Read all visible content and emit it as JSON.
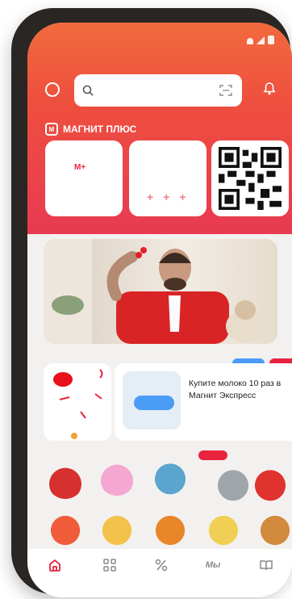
{
  "search": {
    "placeholder": ""
  },
  "brand": {
    "mark": "М",
    "name": "МАГНИТ ПЛЮС"
  },
  "cards": {
    "plus_badge": "М+",
    "dots": [
      "+",
      "+",
      "+"
    ]
  },
  "promo": {
    "text": "Купите молоко 10 раз в Магнит Экспресс"
  },
  "tabbar": {
    "items": [
      {
        "icon": "home-icon"
      },
      {
        "icon": "catalog-icon"
      },
      {
        "icon": "discount-icon"
      },
      {
        "label": "Мы"
      },
      {
        "icon": "book-icon"
      }
    ]
  },
  "colors": {
    "header_top": "#f26a3d",
    "header_bottom": "#e83a52",
    "accent_red": "#e8233e",
    "accent_blue": "#4a9cf5"
  },
  "icons": [
    "search-icon",
    "scanner-icon",
    "bell-icon",
    "profile-icon",
    "qr-code-icon"
  ]
}
